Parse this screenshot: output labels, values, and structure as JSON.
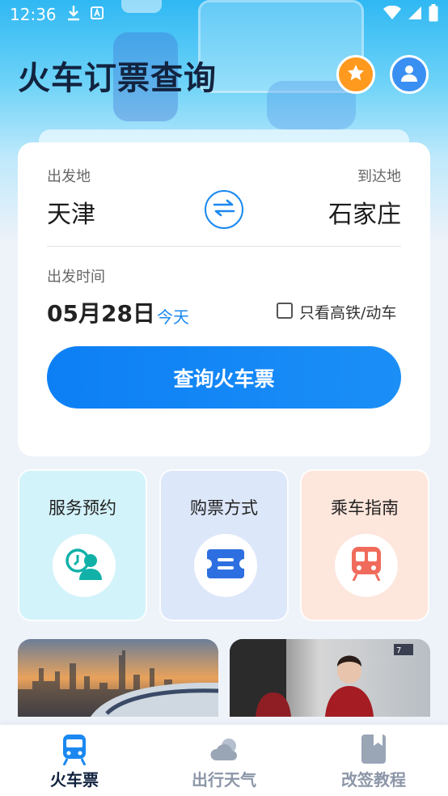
{
  "status_bar": {
    "time": "12:36"
  },
  "header": {
    "title": "火车订票查询"
  },
  "search": {
    "from_label": "出发地",
    "to_label": "到达地",
    "from_city": "天津",
    "to_city": "石家庄",
    "time_label": "出发时间",
    "date": "05月28日",
    "today": "今天",
    "high_speed_label": "只看高铁/动车",
    "search_button": "查询火车票"
  },
  "services": [
    {
      "label": "服务预约",
      "icon": "service-appointment-icon",
      "color": "#11b1a8"
    },
    {
      "label": "购票方式",
      "icon": "ticket-icon",
      "color": "#2d6fe0"
    },
    {
      "label": "乘车指南",
      "icon": "train-icon",
      "color": "#f06b5c"
    }
  ],
  "bottom_nav": [
    {
      "label": "火车票",
      "icon": "train-icon",
      "active": true
    },
    {
      "label": "出行天气",
      "icon": "weather-icon",
      "active": false
    },
    {
      "label": "改签教程",
      "icon": "book-icon",
      "active": false
    }
  ],
  "colors": {
    "accent": "#1a88f0",
    "title": "#12233f",
    "inactive": "#8c96a8"
  }
}
